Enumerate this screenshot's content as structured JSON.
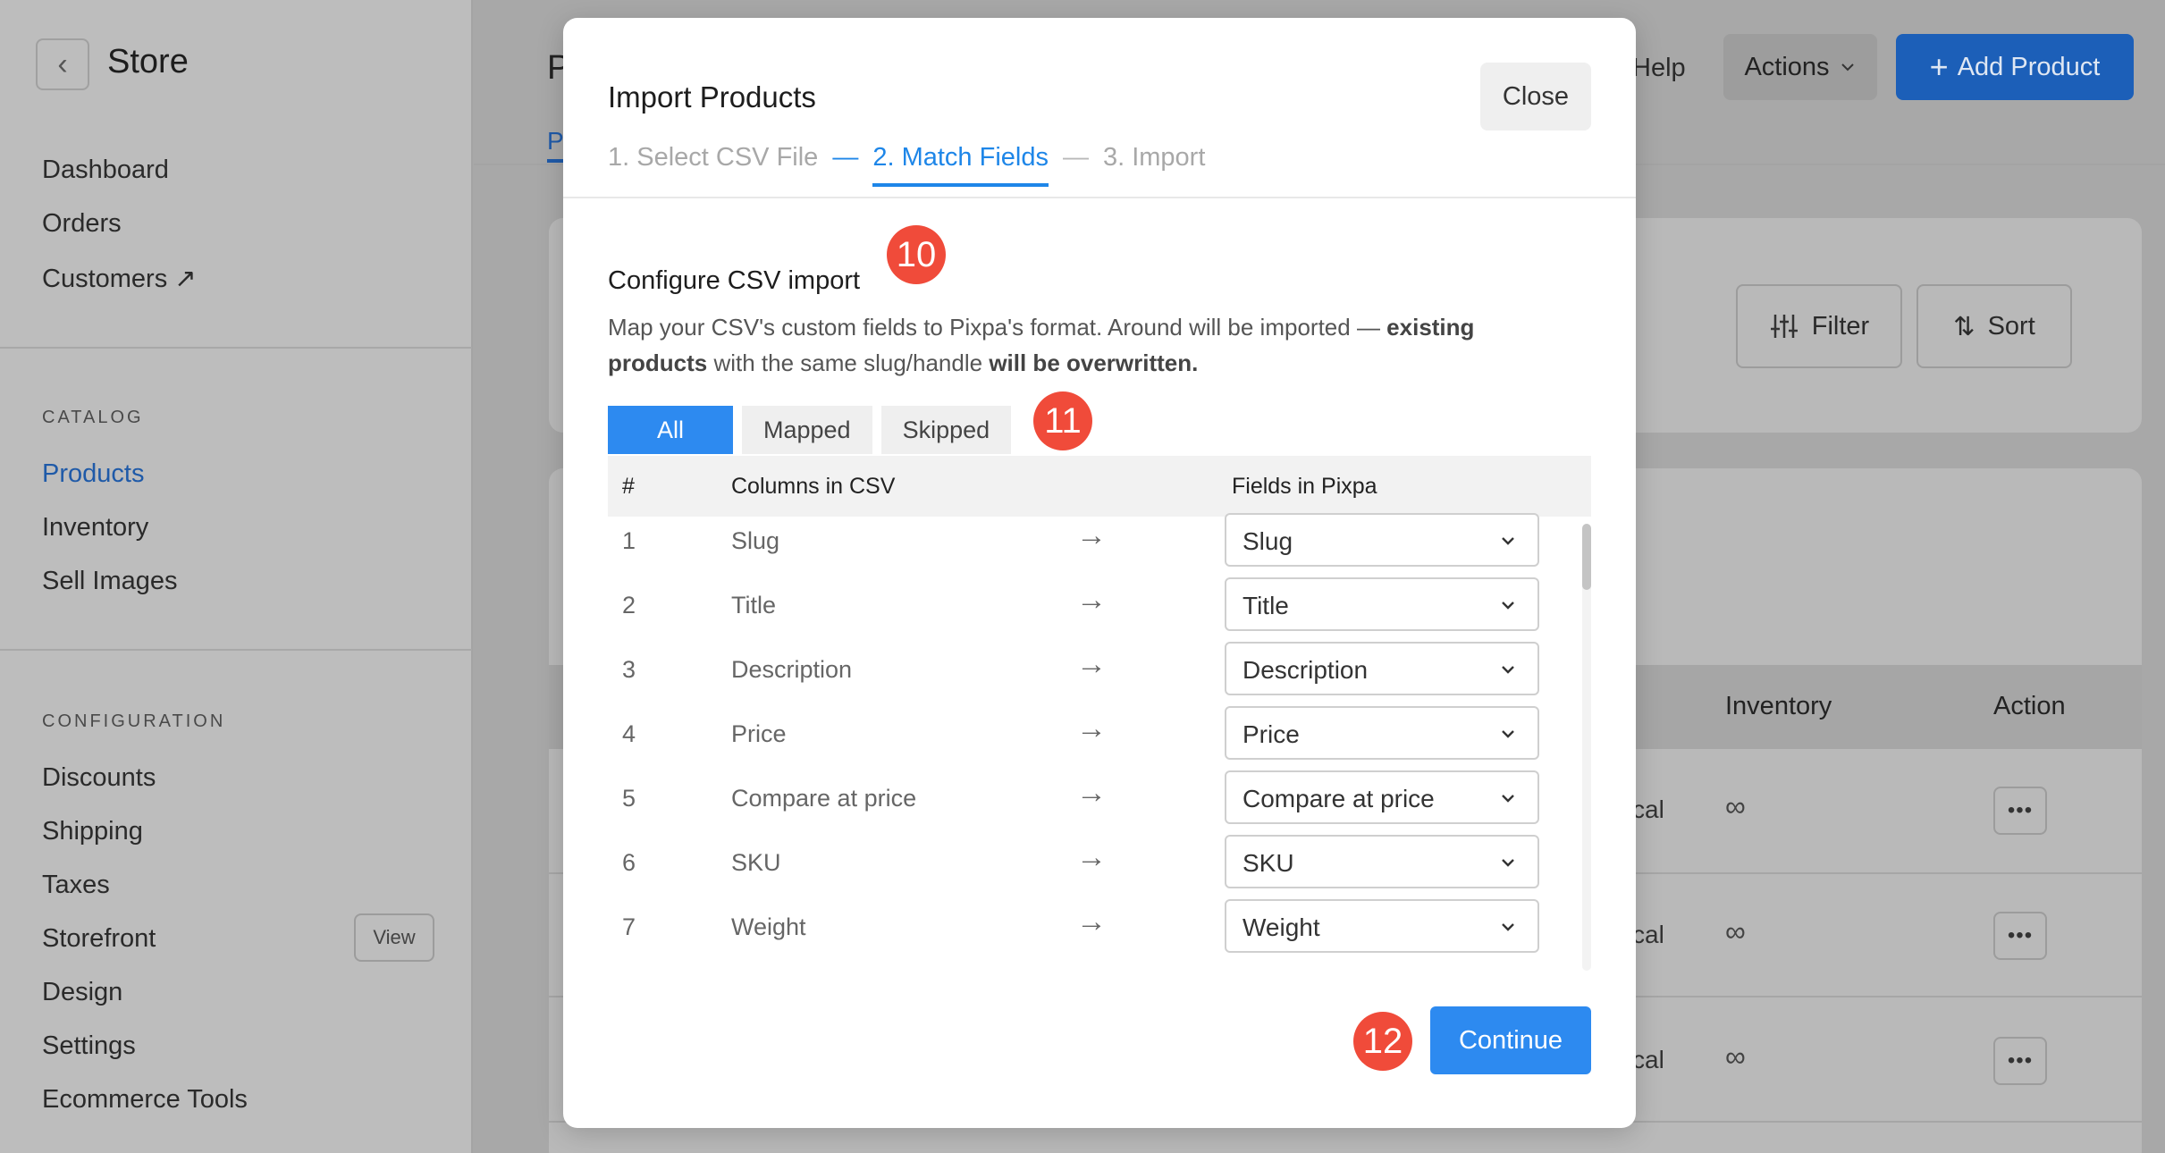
{
  "sidebar": {
    "title": "Store",
    "items_top": [
      "Dashboard",
      "Orders",
      "Customers ↗"
    ],
    "catalog_label": "CATALOG",
    "catalog_items": [
      "Products",
      "Inventory",
      "Sell Images"
    ],
    "config_label": "CONFIGURATION",
    "config_items": [
      "Discounts",
      "Shipping",
      "Taxes",
      "Storefront",
      "Design",
      "Settings",
      "Ecommerce Tools"
    ],
    "view_label": "View"
  },
  "header": {
    "title_partial": "P",
    "tab_partial": "P",
    "help": "Help",
    "actions": "Actions",
    "add_product": "Add Product"
  },
  "toolbar": {
    "filter": "Filter",
    "sort": "Sort"
  },
  "product_table": {
    "columns": [
      "Inventory",
      "Action"
    ],
    "rows": [
      {
        "type_partial": "cal",
        "inventory": "∞"
      },
      {
        "type_partial": "cal",
        "inventory": "∞"
      },
      {
        "type_partial": "cal",
        "inventory": "∞"
      }
    ]
  },
  "modal": {
    "title": "Import Products",
    "close": "Close",
    "steps": [
      "1. Select CSV File",
      "2. Match Fields",
      "3. Import"
    ],
    "active_step": 1,
    "config_title": "Configure CSV import",
    "desc_part1": "Map your CSV's custom fields to Pixpa's format. Around will be imported — ",
    "desc_bold1": "existing products",
    "desc_part2": " with the same slug/handle ",
    "desc_bold2": "will be overwritten.",
    "tabs": [
      "All",
      "Mapped",
      "Skipped"
    ],
    "table_headers": {
      "num": "#",
      "csv": "Columns in CSV",
      "pixpa": "Fields in Pixpa"
    },
    "rows": [
      {
        "num": "1",
        "csv": "Slug",
        "field": "Slug"
      },
      {
        "num": "2",
        "csv": "Title",
        "field": "Title"
      },
      {
        "num": "3",
        "csv": "Description",
        "field": "Description"
      },
      {
        "num": "4",
        "csv": "Price",
        "field": "Price"
      },
      {
        "num": "5",
        "csv": "Compare at price",
        "field": "Compare at price"
      },
      {
        "num": "6",
        "csv": "SKU",
        "field": "SKU"
      },
      {
        "num": "7",
        "csv": "Weight",
        "field": "Weight"
      }
    ],
    "continue": "Continue",
    "badges": [
      "10",
      "11",
      "12"
    ],
    "arrow": "→"
  },
  "colors": {
    "accent": "#2d8af0",
    "badge": "#f04b3a",
    "step_active": "#1e86e8"
  }
}
